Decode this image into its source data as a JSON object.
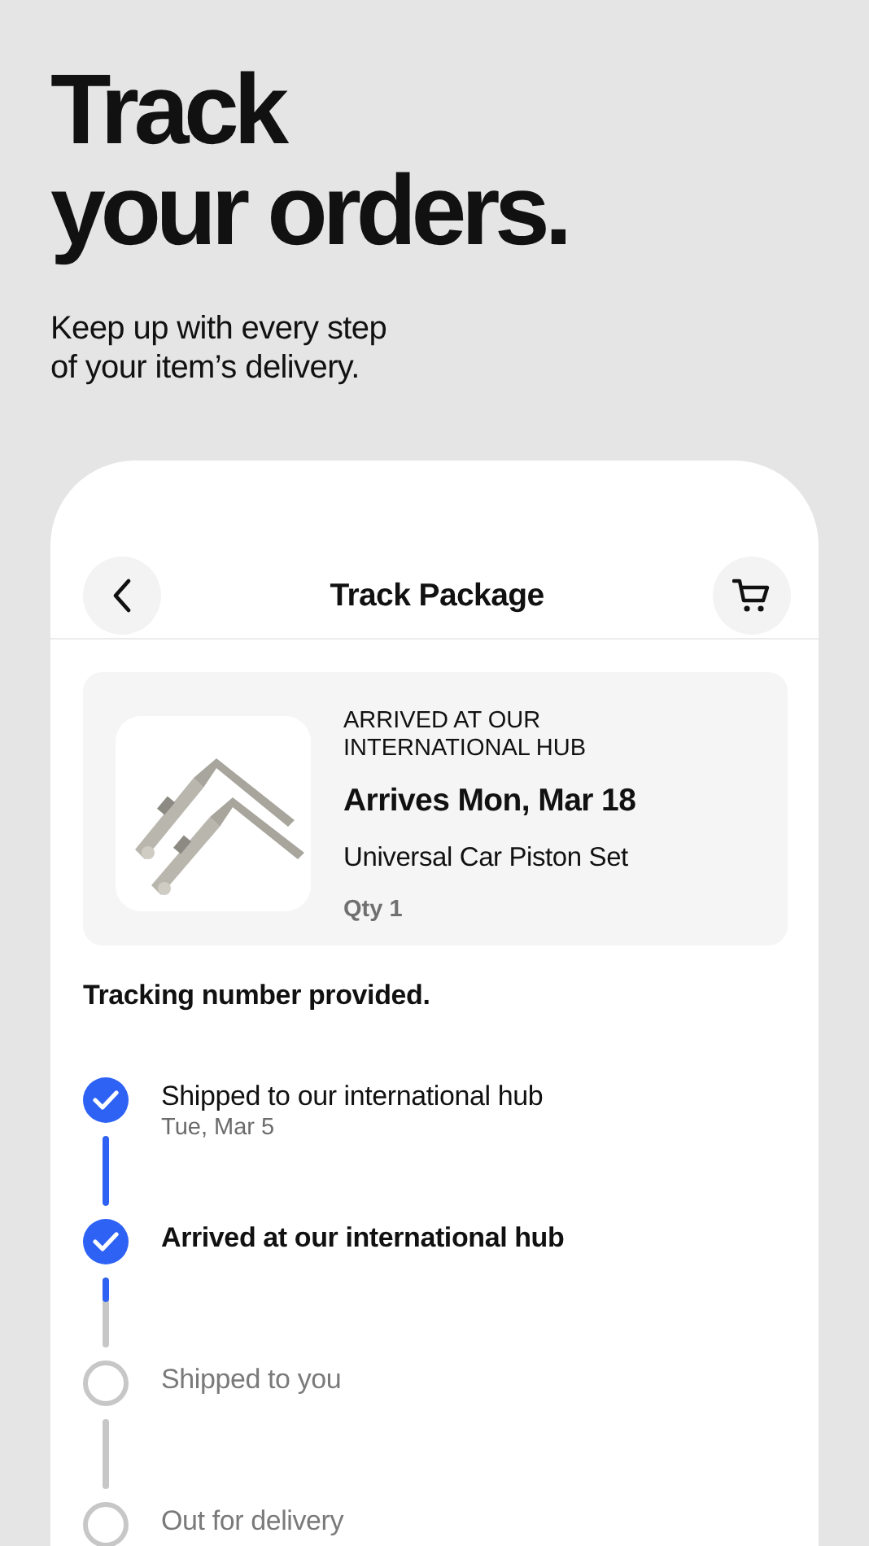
{
  "hero": {
    "title_lines": [
      "Track",
      "your orders."
    ],
    "subtitle_lines": [
      "Keep up with every step",
      "of your item’s delivery."
    ]
  },
  "header": {
    "title": "Track Package"
  },
  "product": {
    "status": "ARRIVED AT OUR INTERNATIONAL HUB",
    "arrival": "Arrives Mon, Mar 18",
    "name": "Universal Car Piston Set",
    "quantity": "Qty 1"
  },
  "tracking_note": "Tracking number provided.",
  "steps": [
    {
      "label": "Shipped to our international hub",
      "date": "Tue, Mar 5",
      "done": true,
      "current": false,
      "connector": {
        "level": 1
      }
    },
    {
      "label": "Arrived at our international hub",
      "done": true,
      "current": true,
      "connector": {
        "level": 0.36
      }
    },
    {
      "label": "Shipped to you",
      "done": false,
      "current": false,
      "connector": {
        "level": 0
      }
    },
    {
      "label": "Out for delivery",
      "done": false,
      "current": false
    }
  ]
}
